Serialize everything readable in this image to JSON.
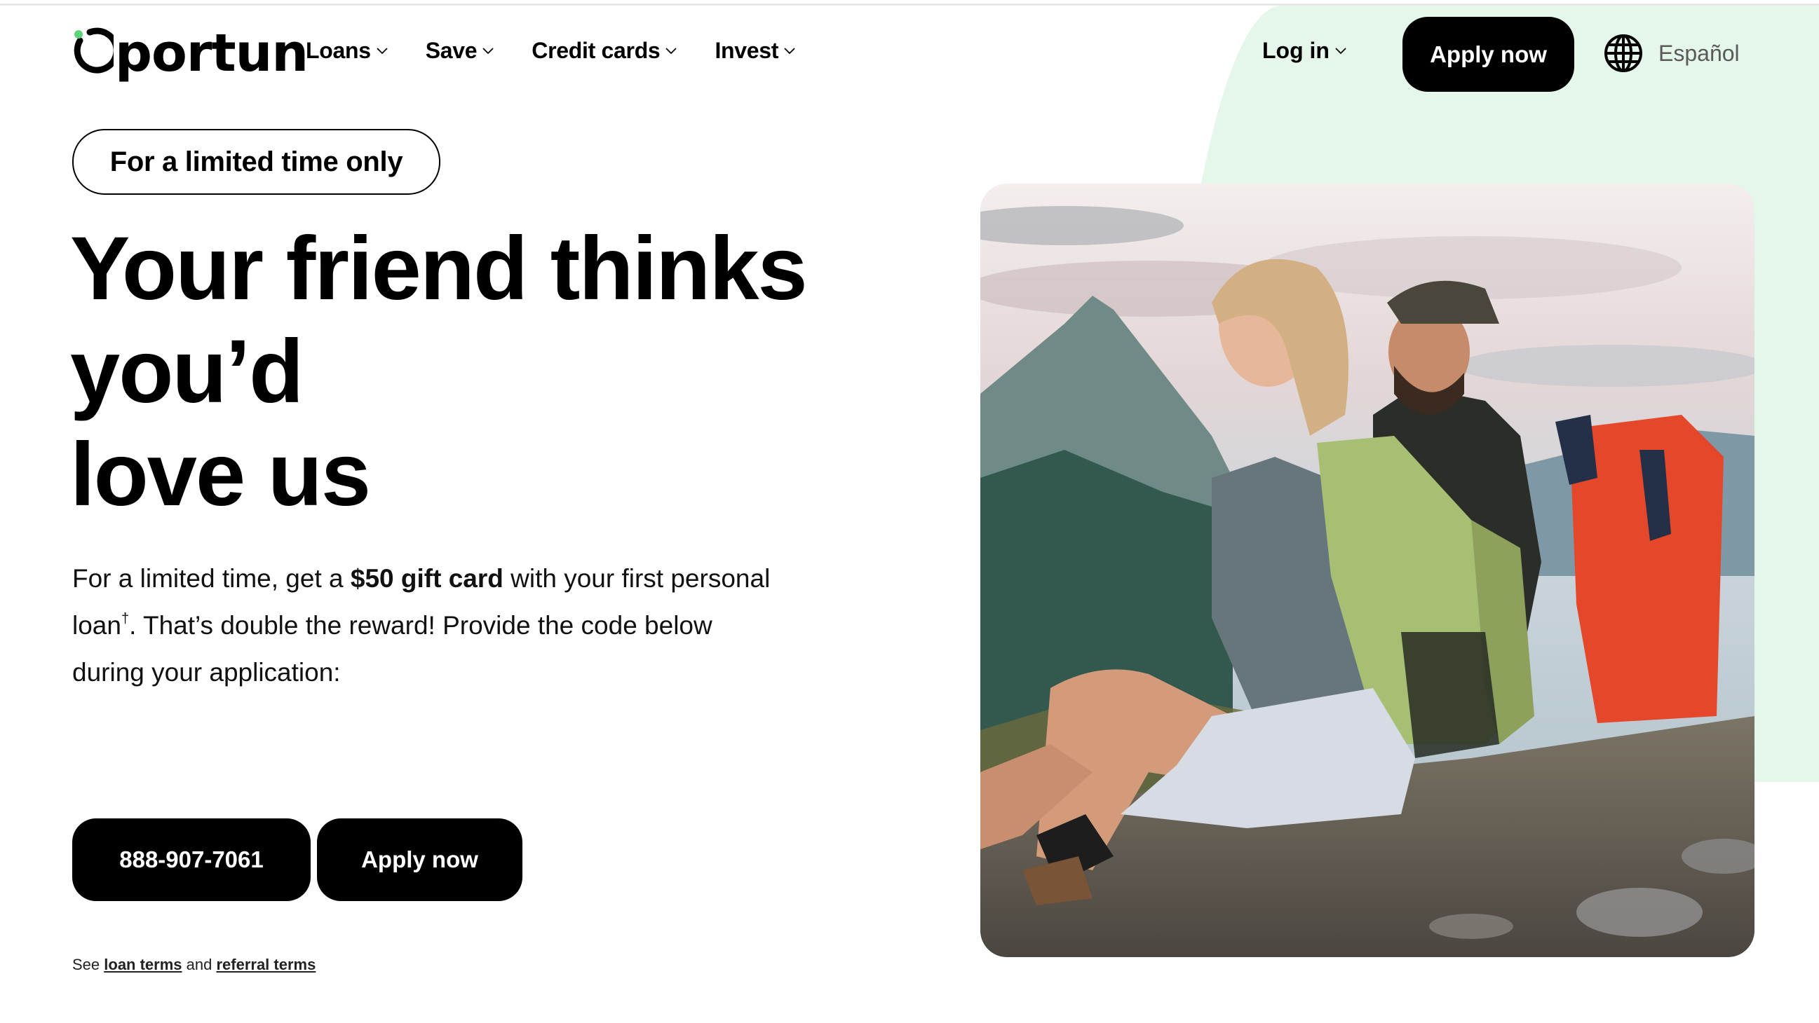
{
  "header": {
    "logo_text": "portun",
    "logo_alt": "Oportun",
    "nav": [
      {
        "label": "Loans"
      },
      {
        "label": "Save"
      },
      {
        "label": "Credit cards"
      },
      {
        "label": "Invest"
      }
    ],
    "login_label": "Log in",
    "apply_label": "Apply now",
    "language_label": "Español"
  },
  "hero": {
    "badge": "For a limited time only",
    "headline": [
      "Your friend thinks",
      "you’d",
      "love us"
    ],
    "intro": {
      "part1": "For a limited time, get a ",
      "bold": "$50 gift card",
      "part2": " with your first personal loan",
      "sup": "†",
      "part3": ". That’s double the reward! Provide the code below during your application:"
    },
    "phone_button": "888-907-7061",
    "apply_button": "Apply now",
    "terms": {
      "prefix": "See ",
      "loan_terms": "loan terms",
      "and": " and ",
      "referral_terms": "referral terms"
    },
    "image_description": "Two hikers with backpacks sitting on a mountain summit"
  },
  "colors": {
    "brand_green": "#5ed17d",
    "accent_bg": "#e5f6ea",
    "button_bg": "#000000",
    "text": "#000000",
    "muted_text": "#5a5a5a"
  }
}
